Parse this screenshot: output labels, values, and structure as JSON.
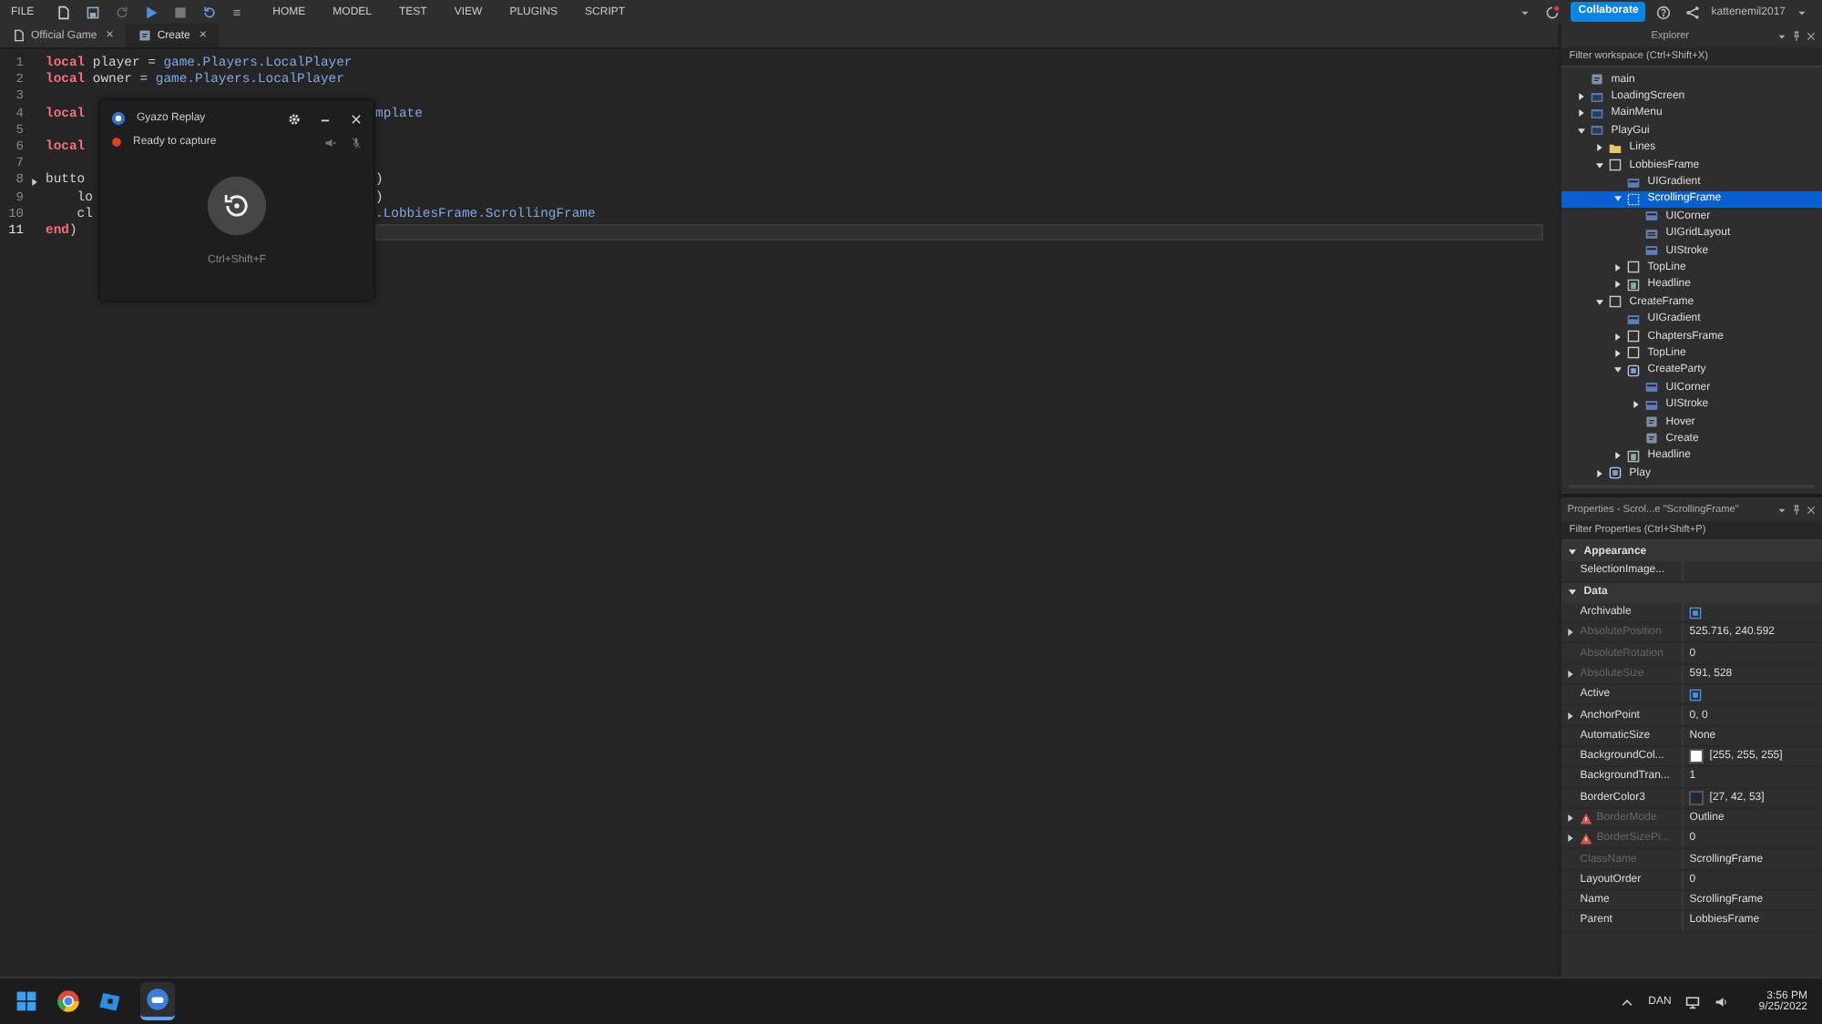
{
  "menu": {
    "file": "FILE",
    "tabs": [
      "HOME",
      "MODEL",
      "TEST",
      "VIEW",
      "PLUGINS",
      "SCRIPT"
    ],
    "collaborate": "Collaborate",
    "user": "kattenemil2017"
  },
  "doc_tabs": [
    {
      "label": "Official Game",
      "close": "×",
      "kind": "place",
      "selected": false
    },
    {
      "label": "Create",
      "close": "×",
      "kind": "script",
      "selected": true
    }
  ],
  "code": [
    {
      "number": "1",
      "fold": false,
      "current": false,
      "left": [
        {
          "t": "local",
          "kind": "kw"
        },
        {
          "t": " player = ",
          "kind": "plain"
        },
        {
          "t": "game.Players.LocalPlayer",
          "kind": "member"
        }
      ]
    },
    {
      "number": "2",
      "fold": false,
      "current": false,
      "left": [
        {
          "t": "local",
          "kind": "kw"
        },
        {
          "t": " owner = ",
          "kind": "plain"
        },
        {
          "t": "game.Players.LocalPlayer",
          "kind": "member"
        }
      ]
    },
    {
      "number": "3",
      "fold": false,
      "current": false
    },
    {
      "number": "4",
      "fold": false,
      "current": false,
      "left": [
        {
          "t": "local",
          "kind": "kw"
        }
      ],
      "right": [
        {
          "t": "mplate",
          "kind": "member"
        }
      ]
    },
    {
      "number": "5",
      "fold": false,
      "current": false
    },
    {
      "number": "6",
      "fold": false,
      "current": false,
      "left": [
        {
          "t": "local",
          "kind": "kw"
        }
      ]
    },
    {
      "number": "7",
      "fold": false,
      "current": false
    },
    {
      "number": "8",
      "fold": true,
      "current": false,
      "left": [
        {
          "t": "butto",
          "kind": "plain"
        }
      ],
      "right": [
        {
          "t": ")",
          "kind": "plain"
        }
      ]
    },
    {
      "number": "9",
      "fold": false,
      "current": false,
      "left": [
        {
          "t": "    lo",
          "kind": "plain"
        }
      ],
      "right": [
        {
          "t": ")",
          "kind": "plain"
        }
      ]
    },
    {
      "number": "10",
      "fold": false,
      "current": false,
      "left": [
        {
          "t": "    cl",
          "kind": "plain"
        }
      ],
      "right": [
        {
          "t": ".LobbiesFrame.ScrollingFrame",
          "kind": "member"
        }
      ]
    },
    {
      "number": "11",
      "fold": false,
      "current": true,
      "left": [
        {
          "t": "end",
          "kind": "kw"
        },
        {
          "t": ")",
          "kind": "plain"
        }
      ]
    }
  ],
  "gyazo": {
    "title": "Gyazo Replay",
    "status": "Ready to capture",
    "shortcut": "Ctrl+Shift+F"
  },
  "explorer": {
    "title": "Explorer",
    "placeholder": "Filter workspace (Ctrl+Shift+X)",
    "tree": [
      {
        "name": "main",
        "kind": "script",
        "selected": false
      },
      {
        "name": "LoadingScreen",
        "kind": "gui",
        "selected": false,
        "expanded": false
      },
      {
        "name": "MainMenu",
        "kind": "gui",
        "selected": false,
        "expanded": false
      },
      {
        "name": "PlayGui",
        "kind": "gui",
        "selected": false,
        "expanded": true,
        "children": [
          {
            "name": "Lines",
            "kind": "folder",
            "selected": false,
            "expanded": false
          },
          {
            "name": "LobbiesFrame",
            "kind": "frame",
            "selected": false,
            "expanded": true,
            "children": [
              {
                "name": "UIGradient",
                "kind": "gradient",
                "selected": false
              },
              {
                "name": "ScrollingFrame",
                "kind": "scroll",
                "selected": true,
                "expanded": true,
                "children": [
                  {
                    "name": "UICorner",
                    "kind": "corner",
                    "selected": false
                  },
                  {
                    "name": "UIGridLayout",
                    "kind": "layout",
                    "selected": false
                  },
                  {
                    "name": "UIStroke",
                    "kind": "gradient",
                    "selected": false
                  }
                ]
              },
              {
                "name": "TopLine",
                "kind": "frame",
                "selected": false,
                "expanded": false
              },
              {
                "name": "Headline",
                "kind": "image",
                "selected": false,
                "expanded": false
              }
            ]
          },
          {
            "name": "CreateFrame",
            "kind": "frame",
            "selected": false,
            "expanded": true,
            "children": [
              {
                "name": "UIGradient",
                "kind": "gradient",
                "selected": false
              },
              {
                "name": "ChaptersFrame",
                "kind": "frame",
                "selected": false,
                "expanded": false
              },
              {
                "name": "TopLine",
                "kind": "frame",
                "selected": false,
                "expanded": false
              },
              {
                "name": "CreateParty",
                "kind": "button",
                "selected": false,
                "expanded": true,
                "children": [
                  {
                    "name": "UICorner",
                    "kind": "corner",
                    "selected": false
                  },
                  {
                    "name": "UIStroke",
                    "kind": "gradient",
                    "selected": false,
                    "expanded": false
                  },
                  {
                    "name": "Hover",
                    "kind": "script",
                    "selected": false
                  },
                  {
                    "name": "Create",
                    "kind": "script",
                    "selected": false
                  }
                ]
              },
              {
                "name": "Headline",
                "kind": "image",
                "selected": false,
                "expanded": false
              }
            ]
          },
          {
            "name": "Play",
            "kind": "button",
            "selected": false,
            "expanded": false
          }
        ]
      }
    ]
  },
  "properties": {
    "title": "Properties - Scrol...e \"ScrollingFrame\"",
    "placeholder": "Filter Properties (Ctrl+Shift+P)",
    "sections": [
      {
        "title": "Appearance",
        "expanded": true,
        "rows": [
          {
            "name": "SelectionImage...",
            "kind": "text",
            "disabled": false
          }
        ]
      },
      {
        "title": "Data",
        "expanded": true,
        "rows": [
          {
            "name": "Archivable",
            "kind": "checkbox",
            "checked": true,
            "disabled": false
          },
          {
            "name": "AbsolutePosition",
            "kind": "text",
            "value": "525.716, 240.592",
            "disabled": true,
            "expanded": false
          },
          {
            "name": "AbsoluteRotation",
            "kind": "text",
            "value": "0",
            "disabled": true
          },
          {
            "name": "AbsoluteSize",
            "kind": "text",
            "value": "591, 528",
            "disabled": true,
            "expanded": false
          },
          {
            "name": "Active",
            "kind": "checkbox",
            "checked": true,
            "disabled": false
          },
          {
            "name": "AnchorPoint",
            "kind": "text",
            "value": "0, 0",
            "disabled": false,
            "expanded": false
          },
          {
            "name": "AutomaticSize",
            "kind": "text",
            "value": "None",
            "disabled": false
          },
          {
            "name": "BackgroundCol...",
            "kind": "color",
            "color": "#ffffff",
            "value": "[255, 255, 255]",
            "disabled": false
          },
          {
            "name": "BackgroundTran...",
            "kind": "text",
            "value": "1",
            "disabled": false
          },
          {
            "name": "BorderColor3",
            "kind": "color",
            "color": "#1b2a35",
            "value": "[27, 42, 53]",
            "disabled": false
          },
          {
            "name": "BorderMode",
            "kind": "text",
            "value": "Outline",
            "disabled": true,
            "warning": true,
            "expanded": false
          },
          {
            "name": "BorderSizePi...",
            "kind": "text",
            "value": "0",
            "disabled": true,
            "warning": true,
            "expanded": false
          },
          {
            "name": "ClassName",
            "kind": "text",
            "value": "ScrollingFrame",
            "disabled": true
          },
          {
            "name": "LayoutOrder",
            "kind": "text",
            "value": "0",
            "disabled": false
          },
          {
            "name": "Name",
            "kind": "text",
            "value": "ScrollingFrame",
            "disabled": false
          },
          {
            "name": "Parent",
            "kind": "text",
            "value": "LobbiesFrame",
            "disabled": false
          }
        ]
      }
    ]
  },
  "taskbar": {
    "language": "DAN",
    "time": "3:56 PM",
    "date": "9/25/2022"
  }
}
